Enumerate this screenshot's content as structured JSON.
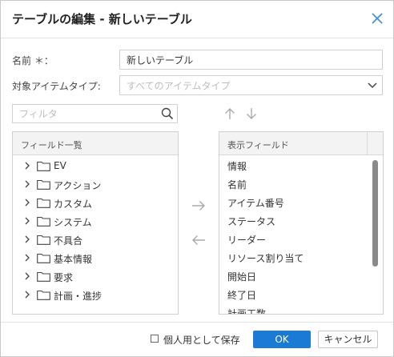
{
  "dialog": {
    "title": "テーブルの編集 - 新しいテーブル"
  },
  "form": {
    "name_label": "名前 ＊：",
    "name_value": "新しいテーブル",
    "item_type_label": "対象アイテムタイプ:",
    "item_type_placeholder": "すべてのアイテムタイプ"
  },
  "filter": {
    "placeholder": "フィルタ"
  },
  "field_list": {
    "header": "フィールド一覧",
    "items": [
      {
        "label": "EV"
      },
      {
        "label": "アクション"
      },
      {
        "label": "カスタム"
      },
      {
        "label": "システム"
      },
      {
        "label": "不具合"
      },
      {
        "label": "基本情報"
      },
      {
        "label": "要求"
      },
      {
        "label": "計画・進捗"
      }
    ]
  },
  "display_fields": {
    "header": "表示フィールド",
    "items": [
      {
        "label": "情報"
      },
      {
        "label": "名前"
      },
      {
        "label": "アイテム番号"
      },
      {
        "label": "ステータス"
      },
      {
        "label": "リーダー"
      },
      {
        "label": "リソース割り当て"
      },
      {
        "label": "開始日"
      },
      {
        "label": "終了日"
      },
      {
        "label": "計画工数"
      }
    ]
  },
  "footer": {
    "personal_checkbox_label": "個人用として保存",
    "ok_label": "OK",
    "cancel_label": "キャンセル"
  },
  "colors": {
    "accent": "#1a7ad4",
    "close_icon": "#3a8fd8"
  }
}
